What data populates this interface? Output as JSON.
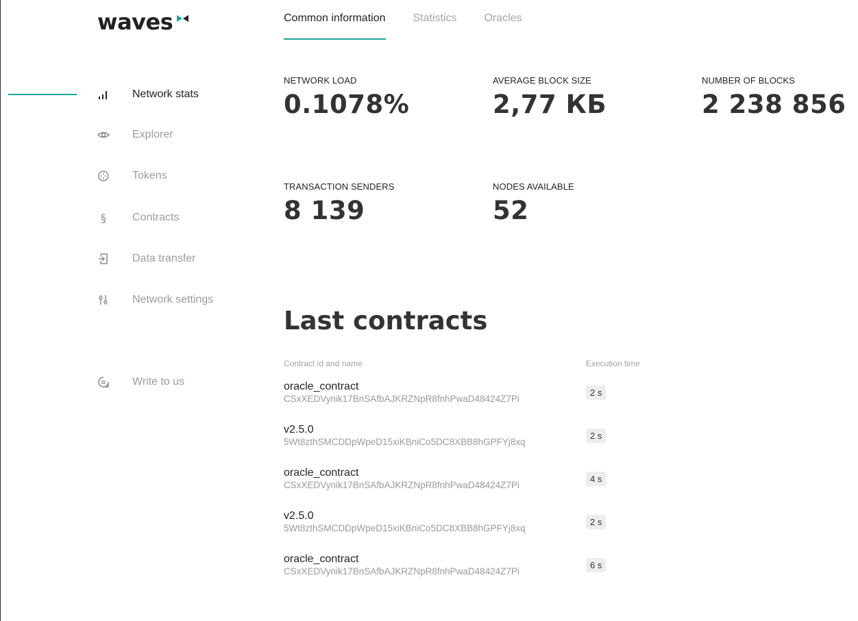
{
  "logo": {
    "text": "waves"
  },
  "tabs": [
    {
      "label": "Common information",
      "active": true
    },
    {
      "label": "Statistics",
      "active": false
    },
    {
      "label": "Oracles",
      "active": false
    }
  ],
  "sidebar": {
    "items": [
      {
        "label": "Network stats",
        "icon": "bar-chart-icon",
        "active": true
      },
      {
        "label": "Explorer",
        "icon": "eye-icon",
        "active": false
      },
      {
        "label": "Tokens",
        "icon": "token-icon",
        "active": false
      },
      {
        "label": "Contracts",
        "icon": "section-icon",
        "active": false
      },
      {
        "label": "Data transfer",
        "icon": "data-transfer-icon",
        "active": false
      },
      {
        "label": "Network settings",
        "icon": "sliders-icon",
        "active": false
      },
      {
        "label": "Write to us",
        "icon": "chat-icon",
        "active": false
      }
    ]
  },
  "stats": {
    "network_load": {
      "label": "NETWORK LOAD",
      "value": "0.1078%"
    },
    "avg_block_size": {
      "label": "AVERAGE BLOCK SIZE",
      "value": "2,77 КБ"
    },
    "num_blocks": {
      "label": "NUMBER OF BLOCKS",
      "value": "2 238 856"
    },
    "tx_senders": {
      "label": "TRANSACTION SENDERS",
      "value": "8 139"
    },
    "nodes": {
      "label": "NODES AVAILABLE",
      "value": "52"
    }
  },
  "contracts": {
    "title": "Last contracts",
    "col_id": "Contract id and name",
    "col_time": "Execution time",
    "rows": [
      {
        "name": "oracle_contract",
        "id": "CSxXEDVynik17BnSAfbAJKRZNpR8fnhPwaD48424Z7Pi",
        "time": "2 s"
      },
      {
        "name": "v2.5.0",
        "id": "5Wt8zthSMCDDpWpeD15xiKBniCo5DC8XBB8hGPFYj8xq",
        "time": "2 s"
      },
      {
        "name": "oracle_contract",
        "id": "CSxXEDVynik17BnSAfbAJKRZNpR8fnhPwaD48424Z7Pi",
        "time": "4 s"
      },
      {
        "name": "v2.5.0",
        "id": "5Wt8zthSMCDDpWpeD15xiKBniCo5DC8XBB8hGPFYj8xq",
        "time": "2 s"
      },
      {
        "name": "oracle_contract",
        "id": "CSxXEDVynik17BnSAfbAJKRZNpR8fnhPwaD48424Z7Pi",
        "time": "6 s"
      }
    ]
  },
  "colors": {
    "accent": "#1aa59a",
    "text": "#222222",
    "muted": "#9b9b9b",
    "badge_bg": "#ededed"
  }
}
